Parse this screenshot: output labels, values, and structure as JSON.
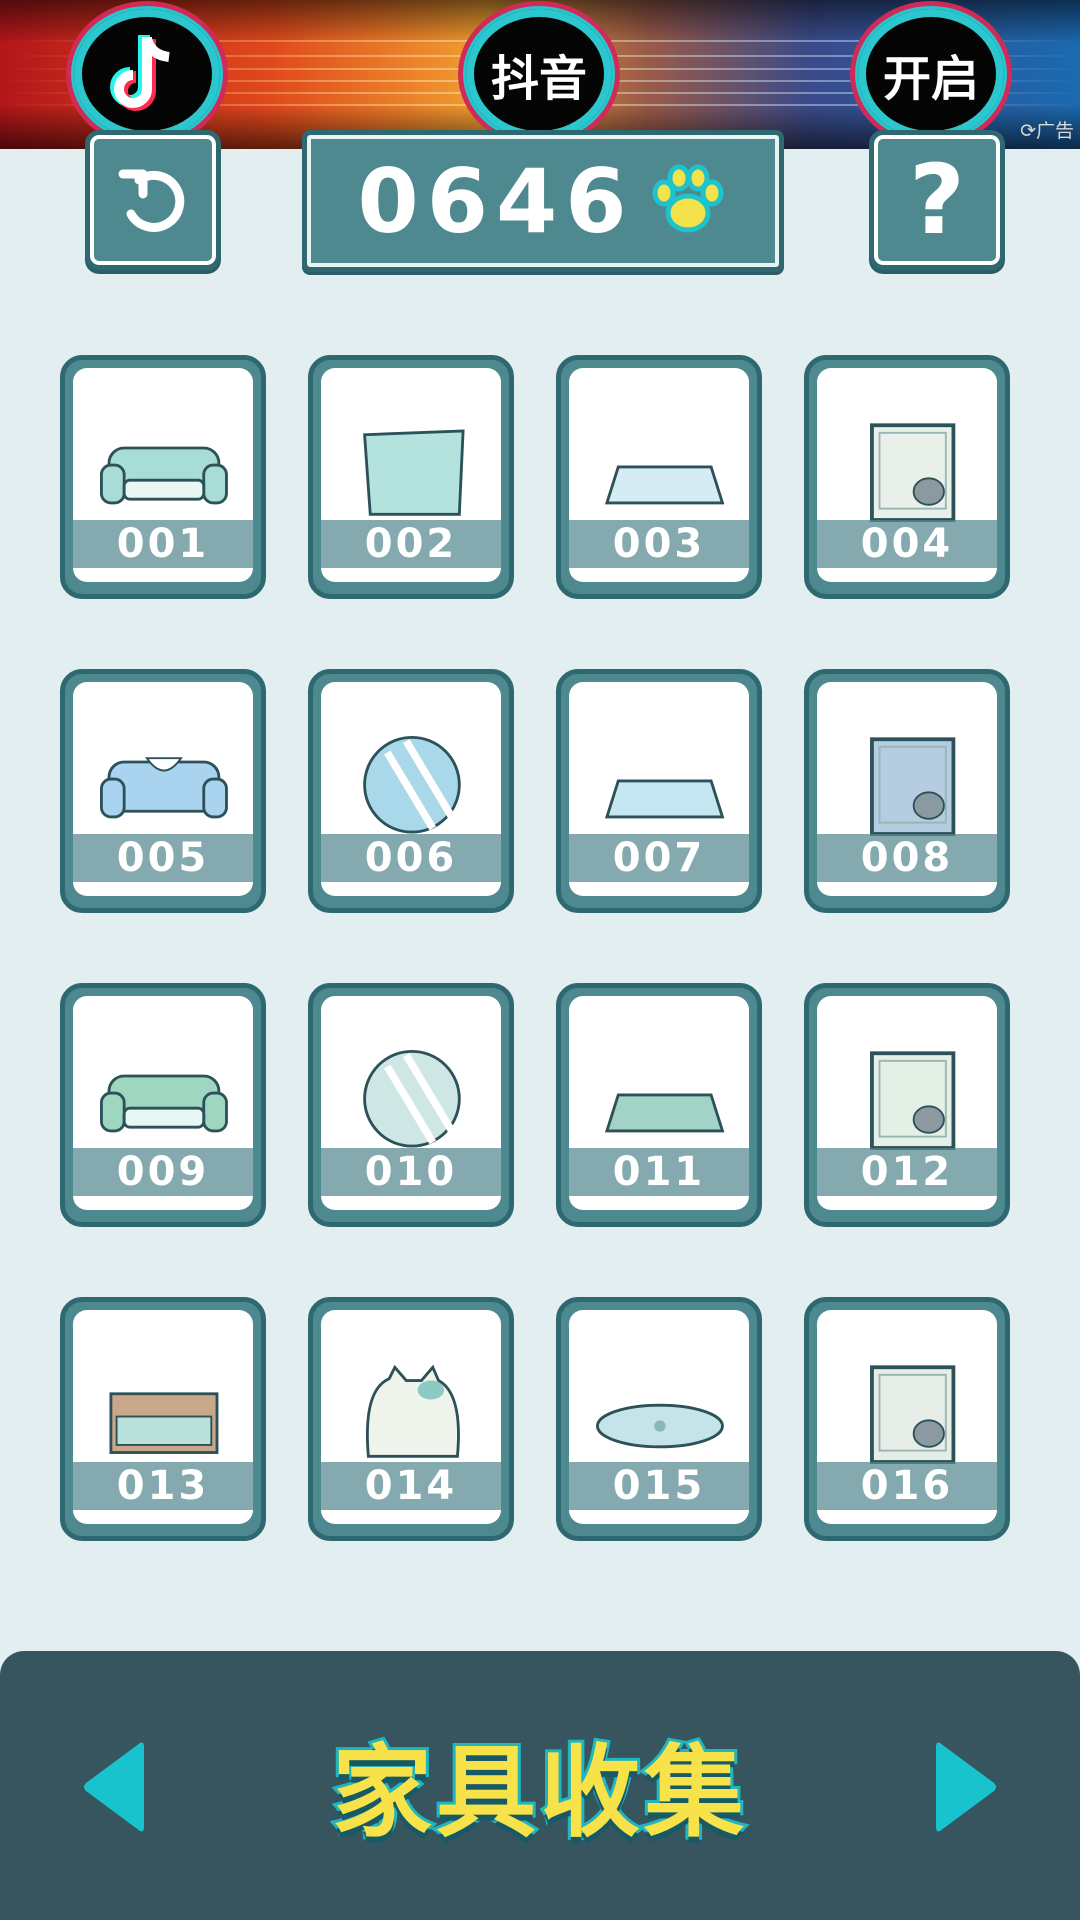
{
  "ad": {
    "buttons": [
      "抖音",
      "开启"
    ],
    "tag": "广告",
    "icons": [
      "douyin-logo-icon"
    ]
  },
  "header": {
    "counter": "0646",
    "help_label": "?",
    "icons": [
      "undo-icon",
      "paw-icon"
    ]
  },
  "grid": {
    "items": [
      {
        "label": "001",
        "art": "sofa",
        "color": "#a8dcd6"
      },
      {
        "label": "002",
        "art": "pillow",
        "color": "#b3e3dc"
      },
      {
        "label": "003",
        "art": "rug",
        "color": "#d6ecf4"
      },
      {
        "label": "004",
        "art": "frame-cat",
        "color": "#e9f0ea"
      },
      {
        "label": "005",
        "art": "sofa-lace",
        "color": "#a9d3ee"
      },
      {
        "label": "006",
        "art": "ball-stripe",
        "color": "#a8d8ea"
      },
      {
        "label": "007",
        "art": "rug",
        "color": "#c6e6f2"
      },
      {
        "label": "008",
        "art": "frame-fish",
        "color": "#b6cce0"
      },
      {
        "label": "009",
        "art": "sofa",
        "color": "#9fd6bf"
      },
      {
        "label": "010",
        "art": "ball-leaf",
        "color": "#cfe7e4"
      },
      {
        "label": "011",
        "art": "rug",
        "color": "#a3d3c6"
      },
      {
        "label": "012",
        "art": "frame-leaf",
        "color": "#e4efe6"
      },
      {
        "label": "013",
        "art": "crib",
        "color": "#b7e1da"
      },
      {
        "label": "014",
        "art": "cat-cushion",
        "color": "#eef4ec"
      },
      {
        "label": "015",
        "art": "oval-rug",
        "color": "#c4e4ea"
      },
      {
        "label": "016",
        "art": "frame-cats",
        "color": "#e6ece6"
      }
    ]
  },
  "footer": {
    "title": "家具收集",
    "icons": [
      "left-arrow-icon",
      "right-arrow-icon"
    ],
    "arrow_color": "#19c3cd",
    "title_color": "#f7e24a"
  }
}
